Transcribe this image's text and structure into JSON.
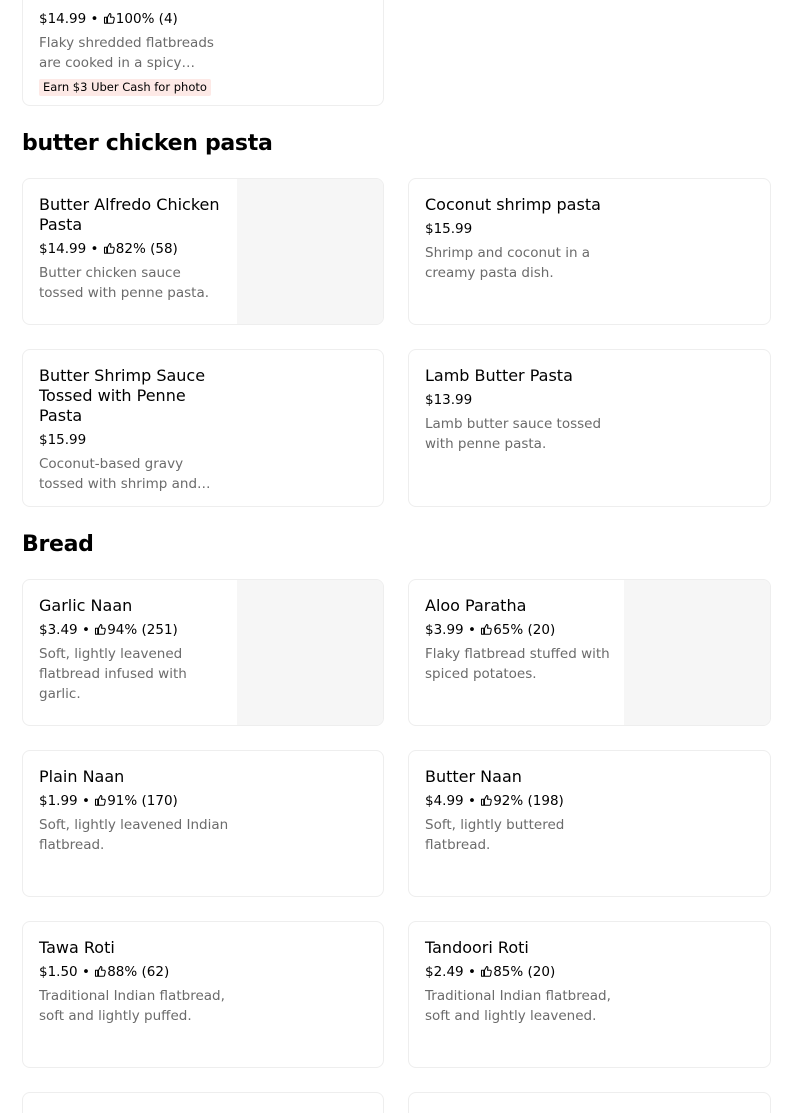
{
  "top_item": {
    "meta": "$14.99 • ",
    "rating": "100% (4)",
    "desc_line1": "Flaky shredded flatbreads",
    "desc_line2": "are cooked in a spicy…",
    "badge": "Earn $3 Uber Cash for photo"
  },
  "sections": {
    "pasta": {
      "title": "butter chicken pasta",
      "items": [
        {
          "name": "Butter Alfredo Chicken Pasta",
          "price": "$14.99 • ",
          "rating": "82% (58)",
          "desc": "Butter chicken sauce tossed with penne pasta."
        },
        {
          "name": "Coconut shrimp pasta",
          "price": "$15.99",
          "rating": "",
          "desc": "Shrimp and coconut in a creamy pasta dish."
        },
        {
          "name": "Butter Shrimp Sauce Tossed with Penne Pasta",
          "price": "$15.99",
          "rating": "",
          "desc": "Coconut-based gravy tossed with shrimp and…"
        },
        {
          "name": "Lamb Butter Pasta",
          "price": "$13.99",
          "rating": "",
          "desc": "Lamb butter sauce tossed with penne pasta."
        }
      ]
    },
    "bread": {
      "title": "Bread",
      "items": [
        {
          "name": "Garlic Naan",
          "price": "$3.49 • ",
          "rating": "94% (251)",
          "desc": "Soft, lightly leavened flatbread infused with garlic."
        },
        {
          "name": "Aloo Paratha",
          "price": "$3.99 • ",
          "rating": "65% (20)",
          "desc": "Flaky flatbread stuffed with spiced potatoes."
        },
        {
          "name": "Plain Naan",
          "price": "$1.99 • ",
          "rating": "91% (170)",
          "desc": "Soft, lightly leavened Indian flatbread."
        },
        {
          "name": "Butter Naan",
          "price": "$4.99 • ",
          "rating": "92% (198)",
          "desc": "Soft, lightly buttered flatbread."
        },
        {
          "name": "Tawa Roti",
          "price": "$1.50 • ",
          "rating": "88% (62)",
          "desc": "Traditional Indian flatbread, soft and lightly puffed."
        },
        {
          "name": "Tandoori Roti",
          "price": "$2.49 • ",
          "rating": "85% (20)",
          "desc": "Traditional Indian flatbread, soft and lightly leavened."
        }
      ]
    }
  },
  "colors": {
    "secondary_text": "#6b6b6b",
    "card_border": "#eeeeee",
    "thumb_placeholder": "#f6f6f6",
    "promo_bg": "#fde9e6"
  },
  "icons": {
    "rating": "thumbs-up-icon"
  }
}
